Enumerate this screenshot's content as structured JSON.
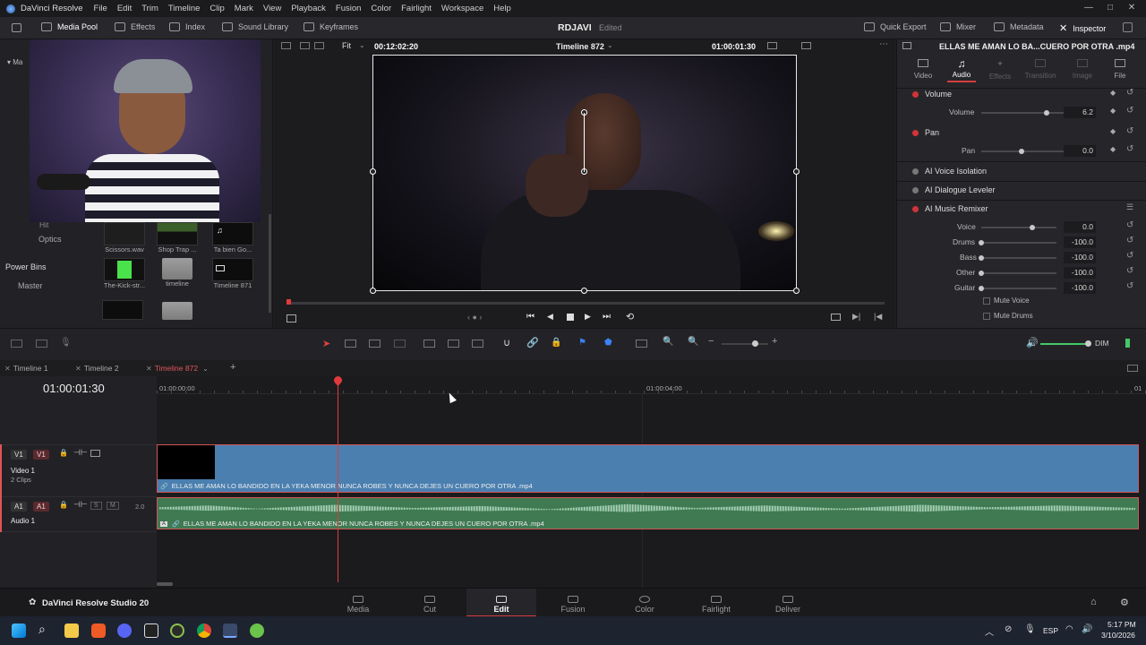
{
  "menubar": {
    "app_name": "DaVinci Resolve",
    "items": [
      "File",
      "Edit",
      "Trim",
      "Timeline",
      "Clip",
      "Mark",
      "View",
      "Playback",
      "Fusion",
      "Color",
      "Fairlight",
      "Workspace",
      "Help"
    ]
  },
  "toolbar": {
    "media_pool": "Media Pool",
    "effects": "Effects",
    "index": "Index",
    "sound_library": "Sound Library",
    "keyframes": "Keyframes",
    "project_name": "RDJAVI",
    "project_status": "Edited",
    "quick_export": "Quick Export",
    "mixer": "Mixer",
    "metadata": "Metadata",
    "inspector": "Inspector"
  },
  "media_pool": {
    "bins": [
      "Hit",
      "Optics"
    ],
    "power_bins_label": "Power Bins",
    "power_bins_master": "Master",
    "clips": [
      {
        "name": "Scissors.wav"
      },
      {
        "name": "Shop Trap ..."
      },
      {
        "name": "Ta bien Go..."
      },
      {
        "name": "The-Kick-str..."
      },
      {
        "name": "timeline"
      },
      {
        "name": "Timeline 871"
      }
    ]
  },
  "viewer": {
    "zoom": "Fit",
    "source_timecode": "00:12:02:20",
    "timeline_name": "Timeline 872",
    "timecode": "01:00:01:30"
  },
  "inspector": {
    "clip_title": "ELLAS ME AMAN LO BA...CUERO POR OTRA .mp4",
    "tabs": [
      "Video",
      "Audio",
      "Effects",
      "Transition",
      "Image",
      "File"
    ],
    "active_tab": "Audio",
    "volume": {
      "header": "Volume",
      "label": "Volume",
      "value": "6.2"
    },
    "pan": {
      "header": "Pan",
      "label": "Pan",
      "value": "0.0"
    },
    "ai_voice_isolation": "AI Voice Isolation",
    "ai_dialogue_leveler": "AI Dialogue Leveler",
    "ai_music_remixer": "AI Music Remixer",
    "remixer": [
      {
        "label": "Voice",
        "value": "0.0"
      },
      {
        "label": "Drums",
        "value": "-100.0"
      },
      {
        "label": "Bass",
        "value": "-100.0"
      },
      {
        "label": "Other",
        "value": "-100.0"
      },
      {
        "label": "Guitar",
        "value": "-100.0"
      }
    ],
    "mute_voice": "Mute Voice",
    "mute_drums": "Mute Drums"
  },
  "timeline": {
    "dim_label": "DIM",
    "tabs": [
      "Timeline 1",
      "Timeline 2",
      "Timeline 872"
    ],
    "active_tab": "Timeline 872",
    "timecode": "01:00:01:30",
    "ruler": [
      "01:00:00:00",
      "01:00:04:00",
      "01"
    ],
    "video_track": {
      "id": "V1",
      "target": "V1",
      "name": "Video 1",
      "info": "2 Clips"
    },
    "audio_track": {
      "id": "A1",
      "target": "A1",
      "name": "Audio 1",
      "solo": "S",
      "mute": "M",
      "channels": "2.0"
    },
    "video_clip_name": "ELLAS ME AMAN LO BANDIDO EN LA YEKA MENOR NUNCA ROBES Y NUNCA DEJES UN CUERO POR OTRA .mp4",
    "audio_clip_name": "ELLAS ME AMAN LO BANDIDO EN LA YEKA MENOR NUNCA ROBES Y NUNCA DEJES UN CUERO POR OTRA .mp4"
  },
  "pagebar": {
    "product": "DaVinci Resolve Studio 20",
    "pages": [
      "Media",
      "Cut",
      "Edit",
      "Fusion",
      "Color",
      "Fairlight",
      "Deliver"
    ],
    "active_page": "Edit"
  },
  "taskbar": {
    "lang": "ESP",
    "time": "5:17 PM",
    "date": "3/10/2026"
  }
}
